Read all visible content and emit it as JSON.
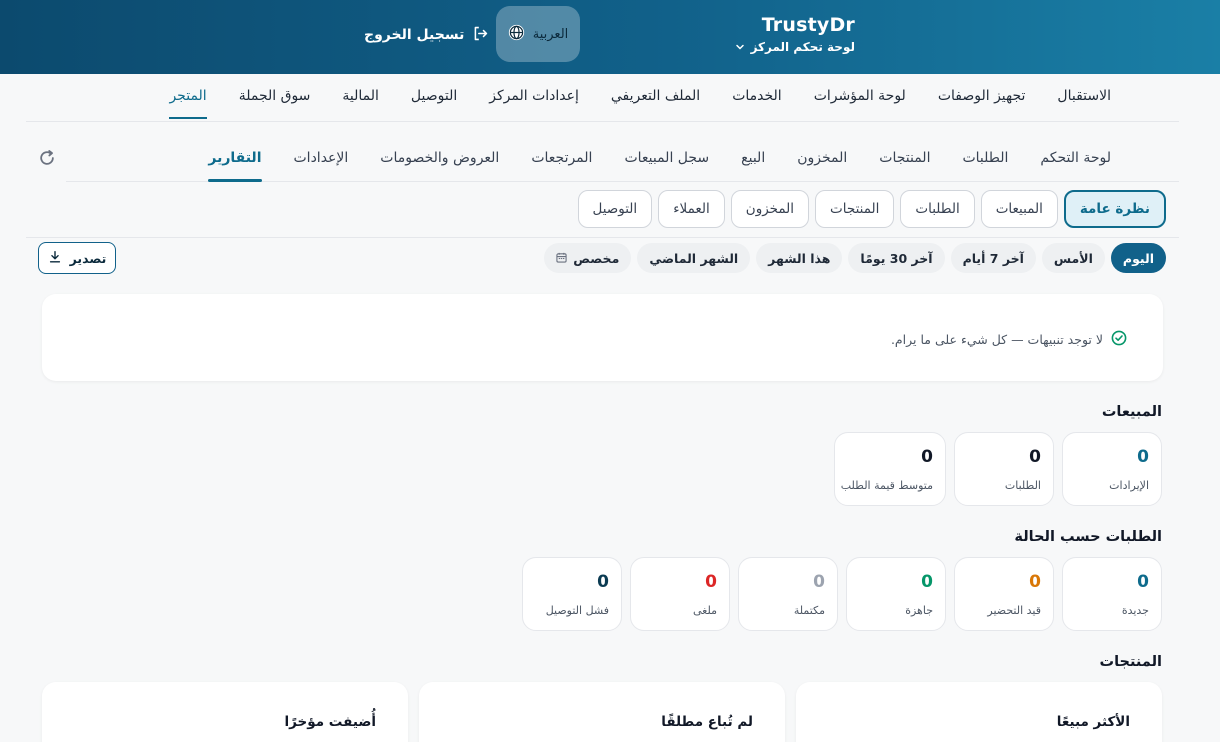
{
  "header": {
    "brand": "TrustyDr",
    "subtitle": "لوحة تحكم المركز",
    "language": "العربية",
    "logout": "تسجيل الخروج"
  },
  "main_nav": [
    {
      "label": "الاستقبال",
      "active": false
    },
    {
      "label": "تجهيز الوصفات",
      "active": false
    },
    {
      "label": "لوحة المؤشرات",
      "active": false
    },
    {
      "label": "الخدمات",
      "active": false
    },
    {
      "label": "الملف التعريفي",
      "active": false
    },
    {
      "label": "إعدادات المركز",
      "active": false
    },
    {
      "label": "التوصيل",
      "active": false
    },
    {
      "label": "المالية",
      "active": false
    },
    {
      "label": "سوق الجملة",
      "active": false
    },
    {
      "label": "المتجر",
      "active": true
    }
  ],
  "sub_nav": [
    {
      "label": "لوحة التحكم",
      "active": false
    },
    {
      "label": "الطلبات",
      "active": false
    },
    {
      "label": "المنتجات",
      "active": false
    },
    {
      "label": "المخزون",
      "active": false
    },
    {
      "label": "البيع",
      "active": false
    },
    {
      "label": "سجل المبيعات",
      "active": false
    },
    {
      "label": "المرتجعات",
      "active": false
    },
    {
      "label": "العروض والخصومات",
      "active": false
    },
    {
      "label": "الإعدادات",
      "active": false
    },
    {
      "label": "التقارير",
      "active": true
    }
  ],
  "report_tabs": [
    {
      "label": "نظرة عامة",
      "active": true
    },
    {
      "label": "المبيعات",
      "active": false
    },
    {
      "label": "الطلبات",
      "active": false
    },
    {
      "label": "المنتجات",
      "active": false
    },
    {
      "label": "المخزون",
      "active": false
    },
    {
      "label": "العملاء",
      "active": false
    },
    {
      "label": "التوصيل",
      "active": false
    }
  ],
  "periods": [
    {
      "label": "اليوم",
      "active": true
    },
    {
      "label": "الأمس",
      "active": false
    },
    {
      "label": "آخر 7 أيام",
      "active": false
    },
    {
      "label": "آخر 30 يومًا",
      "active": false
    },
    {
      "label": "هذا الشهر",
      "active": false
    },
    {
      "label": "الشهر الماضي",
      "active": false
    },
    {
      "label": "مخصص",
      "active": false,
      "icon": "calendar-icon"
    }
  ],
  "export_label": "تصدير",
  "alerts_message": "لا توجد تنبيهات — كل شيء على ما يرام.",
  "sales": {
    "title": "المبيعات",
    "stats": [
      {
        "label": "الإيرادات",
        "value": "0",
        "color": "#0e6b8c"
      },
      {
        "label": "الطلبات",
        "value": "0",
        "color": "#111827"
      },
      {
        "label": "متوسط قيمة الطلب",
        "value": "0",
        "color": "#111827"
      }
    ]
  },
  "orders_by_status": {
    "title": "الطلبات حسب الحالة",
    "stats": [
      {
        "label": "جديدة",
        "value": "0",
        "color": "#0e6b8c"
      },
      {
        "label": "قيد التحضير",
        "value": "0",
        "color": "#d97706"
      },
      {
        "label": "جاهزة",
        "value": "0",
        "color": "#059669"
      },
      {
        "label": "مكتملة",
        "value": "0",
        "color": "#9ca3af"
      },
      {
        "label": "ملغى",
        "value": "0",
        "color": "#dc2626"
      },
      {
        "label": "فشل التوصيل",
        "value": "0",
        "color": "#0b3b52"
      }
    ]
  },
  "products": {
    "title": "المنتجات",
    "cards": [
      "الأكثر مبيعًا",
      "لم تُباع مطلقًا",
      "أُضيفت مؤخرًا"
    ]
  }
}
